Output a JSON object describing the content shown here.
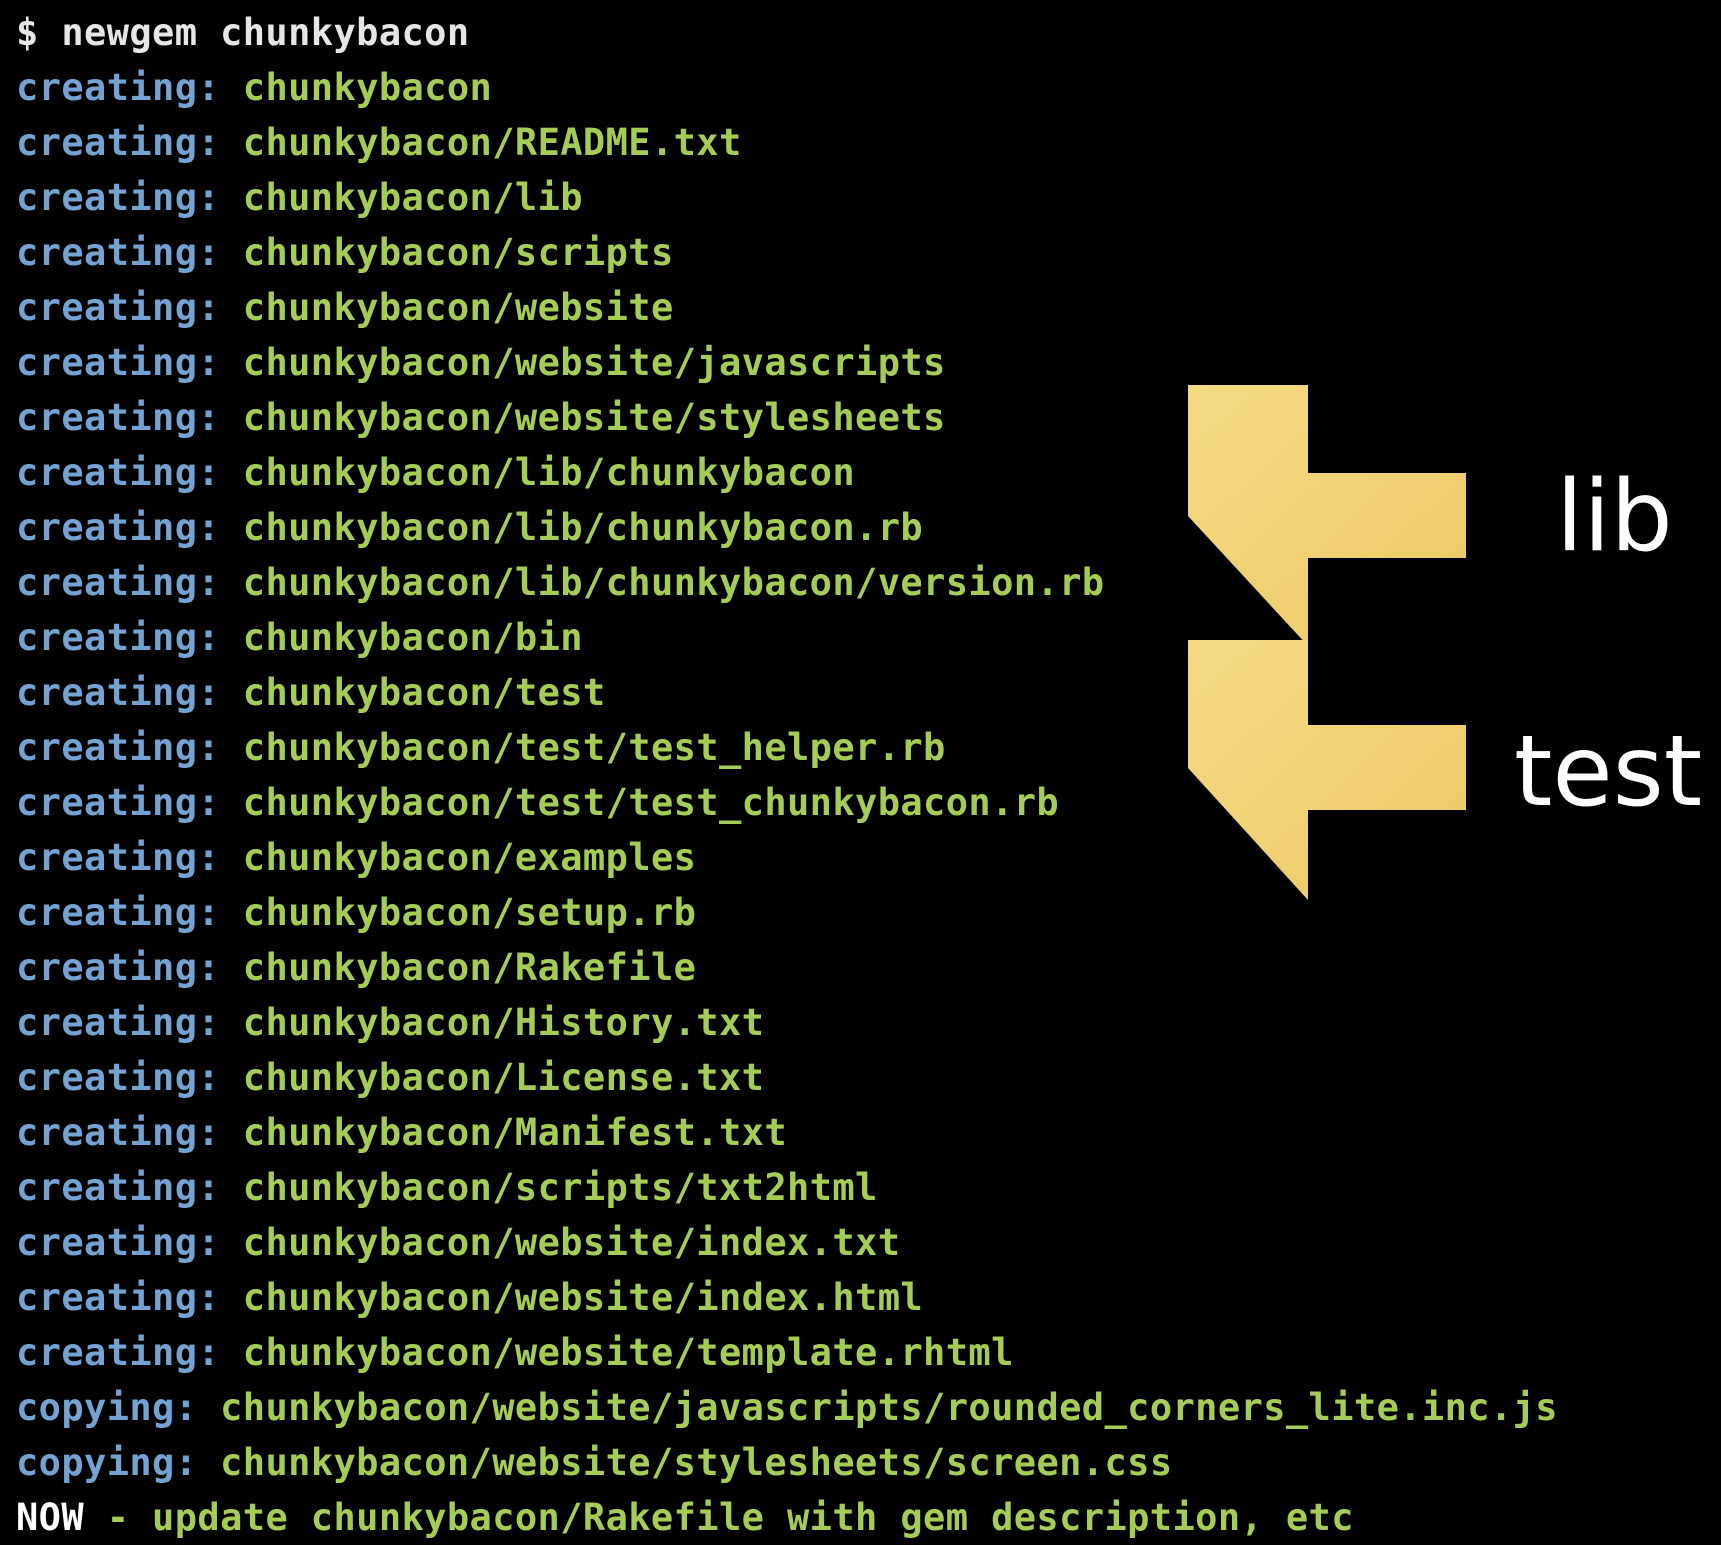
{
  "prompt": "$ newgem chunkybacon",
  "lines": [
    {
      "label": "creating:",
      "path": "chunkybacon"
    },
    {
      "label": "creating:",
      "path": "chunkybacon/README.txt"
    },
    {
      "label": "creating:",
      "path": "chunkybacon/lib"
    },
    {
      "label": "creating:",
      "path": "chunkybacon/scripts"
    },
    {
      "label": "creating:",
      "path": "chunkybacon/website"
    },
    {
      "label": "creating:",
      "path": "chunkybacon/website/javascripts"
    },
    {
      "label": "creating:",
      "path": "chunkybacon/website/stylesheets"
    },
    {
      "label": "creating:",
      "path": "chunkybacon/lib/chunkybacon"
    },
    {
      "label": "creating:",
      "path": "chunkybacon/lib/chunkybacon.rb"
    },
    {
      "label": "creating:",
      "path": "chunkybacon/lib/chunkybacon/version.rb"
    },
    {
      "label": "creating:",
      "path": "chunkybacon/bin"
    },
    {
      "label": "creating:",
      "path": "chunkybacon/test"
    },
    {
      "label": "creating:",
      "path": "chunkybacon/test/test_helper.rb"
    },
    {
      "label": "creating:",
      "path": "chunkybacon/test/test_chunkybacon.rb"
    },
    {
      "label": "creating:",
      "path": "chunkybacon/examples"
    },
    {
      "label": "creating:",
      "path": "chunkybacon/setup.rb"
    },
    {
      "label": "creating:",
      "path": "chunkybacon/Rakefile"
    },
    {
      "label": "creating:",
      "path": "chunkybacon/History.txt"
    },
    {
      "label": "creating:",
      "path": "chunkybacon/License.txt"
    },
    {
      "label": "creating:",
      "path": "chunkybacon/Manifest.txt"
    },
    {
      "label": "creating:",
      "path": "chunkybacon/scripts/txt2html"
    },
    {
      "label": "creating:",
      "path": "chunkybacon/website/index.txt"
    },
    {
      "label": "creating:",
      "path": "chunkybacon/website/index.html"
    },
    {
      "label": "creating:",
      "path": "chunkybacon/website/template.rhtml"
    },
    {
      "label": "copying:",
      "path": "chunkybacon/website/javascripts/rounded_corners_lite.inc.js"
    },
    {
      "label": "copying:",
      "path": "chunkybacon/website/stylesheets/screen.css"
    }
  ],
  "final_line": {
    "prefix": "NOW",
    "text": " - update chunkybacon/Rakefile with gem description, etc"
  },
  "callouts": [
    {
      "label": "lib"
    },
    {
      "label": "test"
    }
  ],
  "colors": {
    "background": "#000000",
    "label": "#73a3d2",
    "path": "#a5cd55",
    "prompt": "#e6e6e6",
    "arrow": "#f1d277",
    "callout_text": "#ffffff"
  }
}
